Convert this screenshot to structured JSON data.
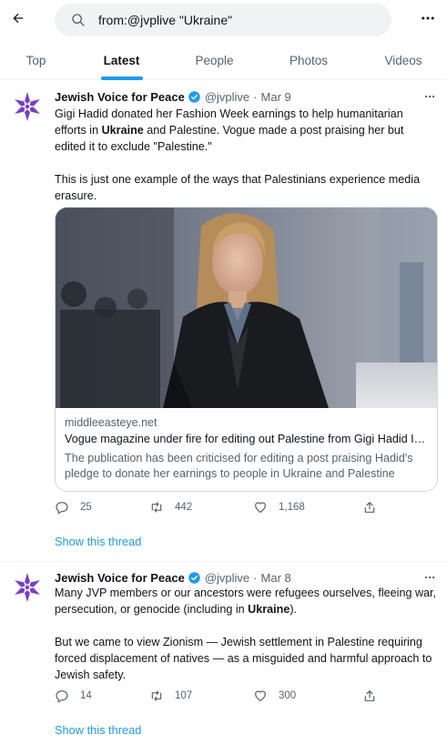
{
  "search": {
    "query": "from:@jvplive \"Ukraine\""
  },
  "tabs": [
    "Top",
    "Latest",
    "People",
    "Photos",
    "Videos"
  ],
  "active_tab": "Latest",
  "colors": {
    "accent": "#1d9bf0",
    "verified": "#1d9bf0",
    "avatar_star": "#7a3ec6",
    "text_secondary": "#536471"
  },
  "icons": [
    "back-arrow-icon",
    "search-icon",
    "more-icon",
    "verified-icon",
    "reply-icon",
    "retweet-icon",
    "like-icon",
    "share-icon"
  ],
  "tweets": [
    {
      "author": "Jewish Voice for Peace",
      "handle": "@jvplive",
      "date": "Mar 9",
      "para1_before": "Gigi Hadid donated her Fashion Week earnings to help humanitarian efforts in ",
      "para1_bold": "Ukraine",
      "para1_after": " and Palestine. Vogue made a post praising her but edited it to exclude \"Palestine.\"",
      "para2": "This is just one example of the ways that Palestinians experience media erasure.",
      "card": {
        "domain": "middleeasteye.net",
        "headline": "Vogue magazine under fire for editing out Palestine from Gigi Hadid In...",
        "description": "The publication has been criticised for editing a post praising Hadid's pledge to donate her earnings to people in Ukraine and Palestine"
      },
      "replies": "25",
      "retweets": "442",
      "likes": "1,168",
      "show_thread": "Show this thread"
    },
    {
      "author": "Jewish Voice for Peace",
      "handle": "@jvplive",
      "date": "Mar 8",
      "para1_before": "Many JVP members or our ancestors were refugees ourselves, fleeing war, persecution, or genocide (including in ",
      "para1_bold": "Ukraine",
      "para1_after": ").",
      "para2": "But we came to view Zionism — Jewish settlement in Palestine requiring forced displacement of natives — as a misguided and harmful approach to Jewish safety.",
      "replies": "14",
      "retweets": "107",
      "likes": "300",
      "show_thread": "Show this thread"
    }
  ]
}
